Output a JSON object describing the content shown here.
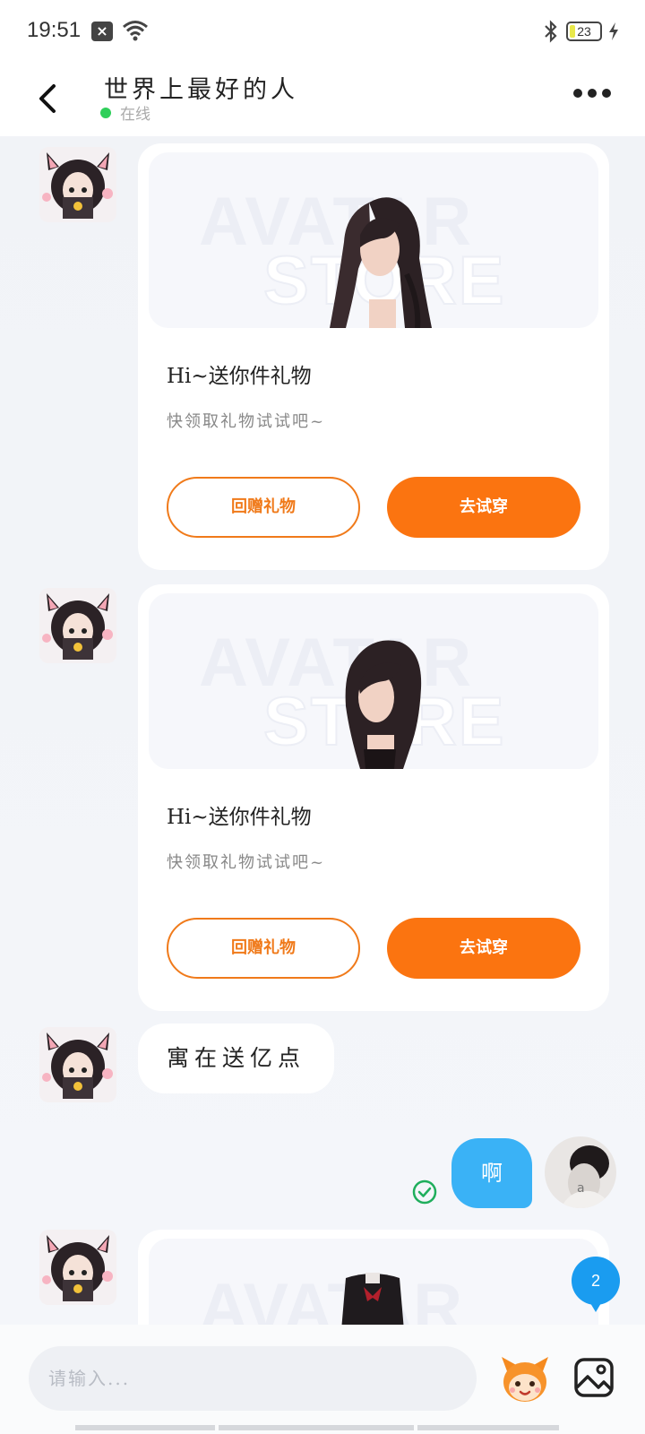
{
  "status_bar": {
    "time": "19:51",
    "battery_level": "23",
    "icons": [
      "notification-x-icon",
      "wifi-icon",
      "bluetooth-icon",
      "battery-icon",
      "charging-bolt-icon"
    ]
  },
  "header": {
    "title": "世界上最好的人",
    "status": "在线",
    "status_color": "#2fcf5a",
    "icons": [
      "back-arrow-icon",
      "more-dots-icon"
    ]
  },
  "messages": [
    {
      "type": "gift_card",
      "watermark_line1": "AVATAR",
      "watermark_line2": "STORE",
      "title": "Hi~送你件礼物",
      "subtitle": "快领取礼物试试吧~",
      "return_label": "回赠礼物",
      "tryon_label": "去试穿"
    },
    {
      "type": "gift_card",
      "watermark_line1": "AVATAR",
      "watermark_line2": "STORE",
      "title": "Hi~送你件礼物",
      "subtitle": "快领取礼物试试吧~",
      "return_label": "回赠礼物",
      "tryon_label": "去试穿"
    },
    {
      "type": "text_in",
      "text": "寓在送亿点"
    },
    {
      "type": "text_out",
      "text": "啊",
      "read": true
    },
    {
      "type": "gift_card_partial",
      "watermark_line1": "AVATAR"
    }
  ],
  "unread_badge": "2",
  "input": {
    "placeholder": "请输入..."
  },
  "colors": {
    "accent_orange": "#fb7410",
    "bubble_blue": "#3ab2f6",
    "badge_blue": "#1a9cf0",
    "background": "#f1f3f7"
  }
}
